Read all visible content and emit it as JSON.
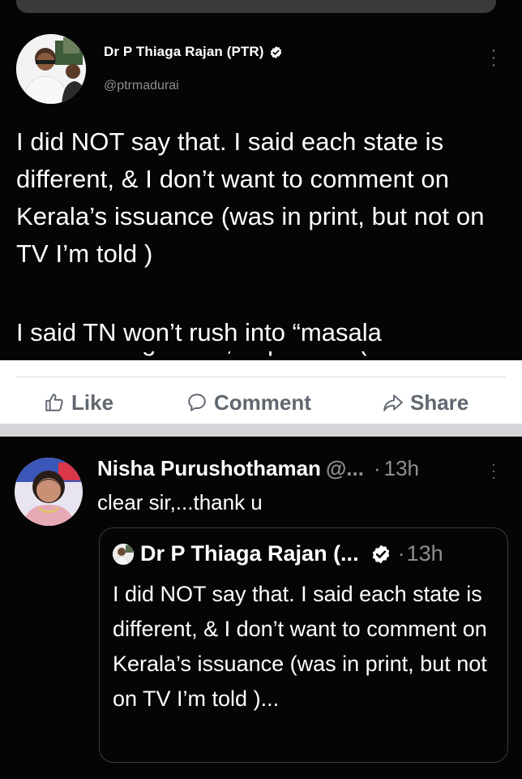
{
  "tweet": {
    "author_name": "Dr P Thiaga Rajan (PTR)",
    "handle": "@ptrmadurai",
    "text": "I did NOT say that. I said each state is different, & I don’t want to comment on Kerala’s issuance (was in print, but not on TV I’m told )",
    "text_2": "I said TN won’t rush into “masala",
    "text_cut": "bonds” - in general, at present (…",
    "icons": {
      "verified": "verified-badge-icon",
      "more": "more-vertical-icon"
    }
  },
  "facebook_actions": {
    "like_label": "Like",
    "comment_label": "Comment",
    "share_label": "Share",
    "colors": {
      "text": "#606770",
      "separator": "#d4d6da"
    }
  },
  "reply": {
    "author_name": "Nisha Purushothaman",
    "handle": "@...",
    "dot": "·",
    "time": "13h",
    "text": "clear sir,...thank u",
    "quoted": {
      "author_name": "Dr P Thiaga Rajan (...",
      "dot": "·",
      "time": "13h",
      "text": "I did NOT say that. I said each state is different, & I don’t want to comment on Kerala’s issuance (was in print, but not on TV I’m told )..."
    }
  }
}
